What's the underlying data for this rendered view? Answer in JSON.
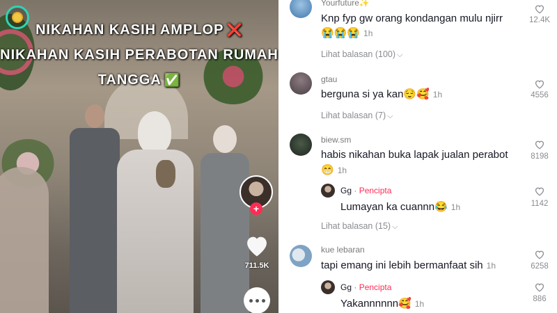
{
  "video": {
    "overlay_lines": [
      {
        "text": "NIKAHAN KASIH AMPLOP",
        "emoji": "❌"
      },
      {
        "text": "NIKAHAN KASIH PERABOTAN RUMAH",
        "emoji": ""
      },
      {
        "text": "TANGGA",
        "emoji": "✅"
      }
    ],
    "like_count": "711.5K",
    "follow_symbol": "+",
    "icons": {
      "live_badge": "live-coin-icon",
      "like": "heart-icon",
      "comment": "comment-dots-icon"
    }
  },
  "comments": [
    {
      "username": "Yourfuture✨",
      "text": "Knp fyp gw orang kondangan mulu njirr",
      "emoji": "😭😭😭",
      "time": "1h",
      "likes": "12.4K",
      "view_replies": "Lihat balasan (100)"
    },
    {
      "username": "gtau",
      "text": "berguna si ya kan😌🥰",
      "time": "1h",
      "likes": "4556",
      "view_replies": "Lihat balasan (7)"
    },
    {
      "username": "biew.sm",
      "text": "habis nikahan buka lapak jualan perabot",
      "emoji": "😁",
      "time": "1h",
      "likes": "8198",
      "reply": {
        "name": "Gg",
        "separator": "·",
        "tag": "Pencipta",
        "text": "Lumayan ka cuannn😂",
        "time": "1h",
        "likes": "1142"
      },
      "view_replies": "Lihat balasan (15)"
    },
    {
      "username": "kue lebaran",
      "text": "tapi emang ini lebih bermanfaat sih",
      "time": "1h",
      "likes": "6258",
      "reply": {
        "name": "Gg",
        "separator": "·",
        "tag": "Pencipta",
        "text": "Yakannnnnn🥰",
        "time": "1h",
        "likes": "886"
      }
    }
  ],
  "colors": {
    "accent": "#fe2c55",
    "text": "#161823",
    "secondary": "#8a8b91",
    "live_ring": "#2fd3b5"
  }
}
